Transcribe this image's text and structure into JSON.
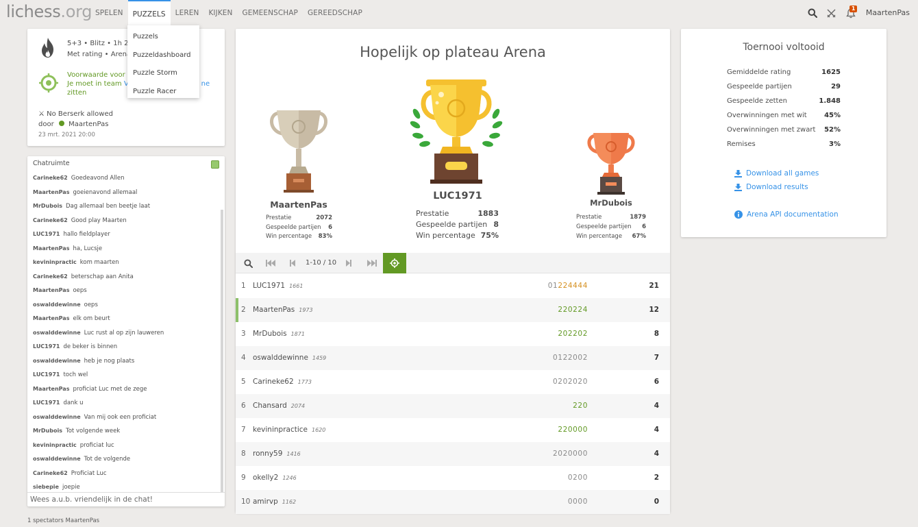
{
  "header": {
    "logo_main": "lichess",
    "logo_tld": ".org",
    "nav": [
      "SPELEN",
      "PUZZELS",
      "LEREN",
      "KIJKEN",
      "GEMEENSCHAP",
      "GEREEDSCHAP"
    ],
    "puzzle_menu": [
      "Puzzels",
      "Puzzeldashboard",
      "Puzzle Storm",
      "Puzzle Racer"
    ],
    "notification_count": "1",
    "username": "MaartenPas"
  },
  "info": {
    "meta_line1": "5+3 • Blitz • 1h 20m",
    "meta_line2": "Met rating • Arena",
    "condition_line1": "Voorwaarde voor",
    "condition_line2a": "Je moet in team ",
    "condition_line2b": "V",
    "condition_line2c": "ne",
    "condition_line3": "zitten",
    "berserk": "No Berserk allowed",
    "by_label": "door",
    "creator": "MaartenPas",
    "date": "23 mrt. 2021 20:00"
  },
  "chat": {
    "title": "Chatruimte",
    "input_placeholder": "Wees a.u.b. vriendelijk in de chat!",
    "messages": [
      {
        "user": "Carineke62",
        "text": "Goedeavond Allen"
      },
      {
        "user": "MaartenPas",
        "text": "goeienavond allemaal"
      },
      {
        "user": "MrDubois",
        "text": "Dag allemaal ben beetje laat"
      },
      {
        "user": "Carineke62",
        "text": "Good play Maarten"
      },
      {
        "user": "LUC1971",
        "text": "hallo fieldplayer"
      },
      {
        "user": "MaartenPas",
        "text": "ha, Lucsje"
      },
      {
        "user": "kevininpractic",
        "text": "kom maarten"
      },
      {
        "user": "Carineke62",
        "text": "beterschap aan Anita"
      },
      {
        "user": "MaartenPas",
        "text": "oeps"
      },
      {
        "user": "oswalddewinne",
        "text": "oeps"
      },
      {
        "user": "MaartenPas",
        "text": "elk om beurt"
      },
      {
        "user": "oswalddewinne",
        "text": "Luc rust al op zijn lauweren"
      },
      {
        "user": "LUC1971",
        "text": "de beker is binnen"
      },
      {
        "user": "oswalddewinne",
        "text": "heb je nog plaats"
      },
      {
        "user": "LUC1971",
        "text": "toch wel"
      },
      {
        "user": "MaartenPas",
        "text": "proficiat Luc met de zege"
      },
      {
        "user": "LUC1971",
        "text": "dank u"
      },
      {
        "user": "oswalddewinne",
        "text": "Van mij ook een proficiat"
      },
      {
        "user": "MrDubois",
        "text": "Tot volgende week"
      },
      {
        "user": "kevininpractic",
        "text": "proficiat luc"
      },
      {
        "user": "oswalddewinne",
        "text": "Tot de volgende"
      },
      {
        "user": "Carineke62",
        "text": "Proficiat Luc"
      },
      {
        "user": "siebepie",
        "text": "joepie"
      }
    ],
    "spectators": "1 spectators MaartenPas"
  },
  "main": {
    "title": "Hopelijk op plateau Arena",
    "stat_labels": {
      "perf": "Prestatie",
      "games": "Gespeelde partijen",
      "win": "Win percentage"
    },
    "podium": {
      "first": {
        "name": "LUC1971",
        "perf": "1883",
        "games": "8",
        "win": "75%"
      },
      "second": {
        "name": "MaartenPas",
        "perf": "2072",
        "games": "6",
        "win": "83%"
      },
      "third": {
        "name": "MrDubois",
        "perf": "1879",
        "games": "6",
        "win": "67%"
      }
    },
    "pager": {
      "count": "1-10 / 10"
    },
    "standings": [
      {
        "rank": "1",
        "name": "LUC1971",
        "rating": "1661",
        "sheet": [
          {
            "t": "01",
            "c": ""
          },
          {
            "t": "224444",
            "c": "s"
          }
        ],
        "score": "21",
        "me": false
      },
      {
        "rank": "2",
        "name": "MaartenPas",
        "rating": "1973",
        "sheet": [
          {
            "t": "220224",
            "c": "w"
          }
        ],
        "score": "12",
        "me": true
      },
      {
        "rank": "3",
        "name": "MrDubois",
        "rating": "1871",
        "sheet": [
          {
            "t": "202202",
            "c": "w"
          }
        ],
        "score": "8",
        "me": false
      },
      {
        "rank": "4",
        "name": "oswalddewinne",
        "rating": "1459",
        "sheet": [
          {
            "t": "0122002",
            "c": ""
          }
        ],
        "score": "7",
        "me": false
      },
      {
        "rank": "5",
        "name": "Carineke62",
        "rating": "1773",
        "sheet": [
          {
            "t": "0202020",
            "c": ""
          }
        ],
        "score": "6",
        "me": false
      },
      {
        "rank": "6",
        "name": "Chansard",
        "rating": "2074",
        "sheet": [
          {
            "t": "220",
            "c": "w"
          }
        ],
        "score": "4",
        "me": false
      },
      {
        "rank": "7",
        "name": "kevininpractice",
        "rating": "1620",
        "sheet": [
          {
            "t": "220000",
            "c": "w"
          }
        ],
        "score": "4",
        "me": false
      },
      {
        "rank": "8",
        "name": "ronny59",
        "rating": "1416",
        "sheet": [
          {
            "t": "2020000",
            "c": ""
          }
        ],
        "score": "4",
        "me": false
      },
      {
        "rank": "9",
        "name": "okelly2",
        "rating": "1246",
        "sheet": [
          {
            "t": "0200",
            "c": ""
          }
        ],
        "score": "2",
        "me": false
      },
      {
        "rank": "10",
        "name": "amirvp",
        "rating": "1162",
        "sheet": [
          {
            "t": "0000",
            "c": ""
          }
        ],
        "score": "0",
        "me": false
      }
    ]
  },
  "finished": {
    "title": "Toernooi voltooid",
    "stats": [
      {
        "label": "Gemiddelde rating",
        "value": "1625"
      },
      {
        "label": "Gespeelde partijen",
        "value": "29"
      },
      {
        "label": "Gespeelde zetten",
        "value": "1.848"
      },
      {
        "label": "Overwinningen met wit",
        "value": "45%"
      },
      {
        "label": "Overwinningen met zwart",
        "value": "52%"
      },
      {
        "label": "Remises",
        "value": "3%"
      }
    ],
    "download_games": "Download all games",
    "download_results": "Download results",
    "api_docs": "Arena API documentation"
  },
  "colors": {
    "accent": "#3692e7",
    "green": "#629924",
    "streak": "#d59020",
    "gold": "#f5c02f",
    "silver": "#c8bba5",
    "bronze": "#ef7a4a"
  }
}
